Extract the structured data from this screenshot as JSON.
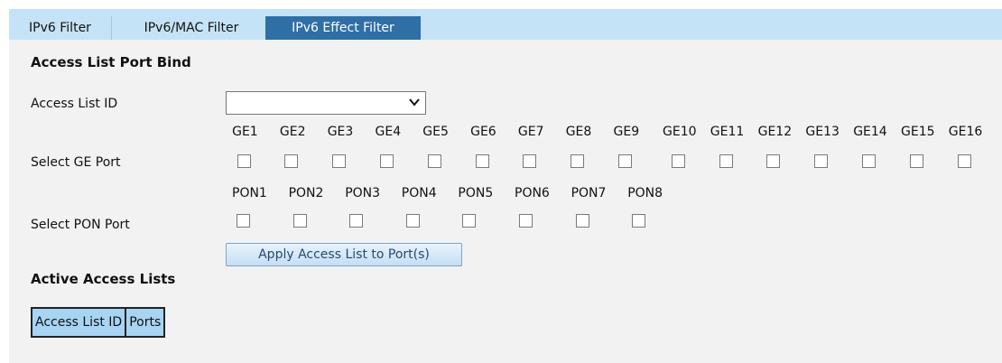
{
  "tabs": [
    {
      "label": "IPv6 Filter",
      "active": false
    },
    {
      "label": "IPv6/MAC Filter",
      "active": false
    },
    {
      "label": "IPv6 Effect Filter",
      "active": true
    }
  ],
  "colors": {
    "tab_bar": "#c4e3f6",
    "tab_active": "#2f6fa6",
    "panel": "#f2f2f2",
    "table_header": "#a7d4f2"
  },
  "bind_section": {
    "title": "Access List Port Bind",
    "acl_label": "Access List ID",
    "acl_value": "",
    "ge_label": "Select GE Port",
    "ge_ports": [
      "GE1",
      "GE2",
      "GE3",
      "GE4",
      "GE5",
      "GE6",
      "GE7",
      "GE8",
      "GE9",
      "GE10",
      "GE11",
      "GE12",
      "GE13",
      "GE14",
      "GE15",
      "GE16"
    ],
    "pon_label": "Select PON Port",
    "pon_ports": [
      "PON1",
      "PON2",
      "PON3",
      "PON4",
      "PON5",
      "PON6",
      "PON7",
      "PON8"
    ],
    "apply_label": "Apply Access List to Port(s)"
  },
  "active_section": {
    "title": "Active Access Lists",
    "columns": [
      "Access List ID",
      "Ports"
    ]
  }
}
